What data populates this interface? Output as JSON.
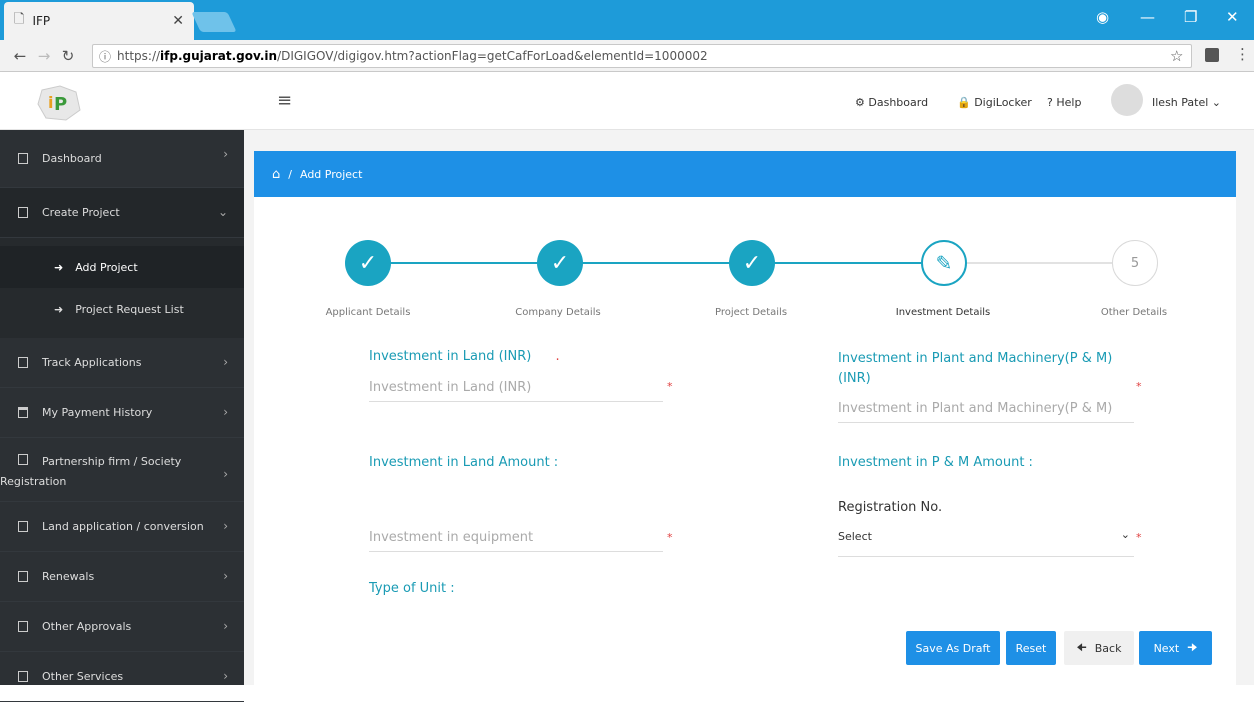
{
  "browser": {
    "tab_title": "IFP",
    "url_prefix": "https://",
    "url_host": "ifp.gujarat.gov.in",
    "url_path": "/DIGIGOV/digigov.htm?actionFlag=getCafForLoad&elementId=1000002"
  },
  "header": {
    "nav": {
      "dashboard": "Dashboard",
      "digilocker": "DigiLocker",
      "help": "Help",
      "user": "Ilesh Patel"
    }
  },
  "sidebar": {
    "items": [
      {
        "label": "Dashboard"
      },
      {
        "label": "Create Project"
      },
      {
        "label": "Track Applications"
      },
      {
        "label": "My Payment History"
      },
      {
        "label": "Partnership firm / Society"
      },
      {
        "label": "Land application / conversion"
      },
      {
        "label": "Renewals"
      },
      {
        "label": "Other Approvals"
      },
      {
        "label": "Other Services"
      }
    ],
    "partnership_line2": "Registration",
    "sub_items": [
      {
        "label": "Add Project"
      },
      {
        "label": "Project Request List"
      }
    ]
  },
  "breadcrumb": {
    "separator": "/",
    "current": "Add Project"
  },
  "steps": [
    {
      "label": "Applicant Details",
      "state": "done"
    },
    {
      "label": "Company Details",
      "state": "done"
    },
    {
      "label": "Project Details",
      "state": "done"
    },
    {
      "label": "Investment Details",
      "state": "current"
    },
    {
      "label": "Other Details",
      "state": "todo",
      "number": "5"
    }
  ],
  "form": {
    "land_label": "Investment in Land (INR)",
    "land_dot": ".",
    "land_placeholder": "Investment in Land (INR)",
    "pm_label_line1": "Investment in Plant and Machinery(P & M)",
    "pm_label_line2": "(INR)",
    "pm_placeholder": "Investment in Plant and Machinery(P & M)",
    "land_amount_label": "Investment in Land Amount :",
    "pm_amount_label": "Investment in P & M Amount :",
    "registration_label": "Registration No.",
    "equipment_placeholder": "Investment in equipment",
    "registration_select": "Select",
    "unit_type_label": "Type of Unit :",
    "required_mark": "*"
  },
  "actions": {
    "save_draft": "Save As Draft",
    "reset": "Reset",
    "back": "Back",
    "next": "Next"
  },
  "colors": {
    "accent": "#1e90e6",
    "step": "#1aa4c2",
    "sidebar": "#2c3034",
    "browser": "#1e9bd9"
  }
}
